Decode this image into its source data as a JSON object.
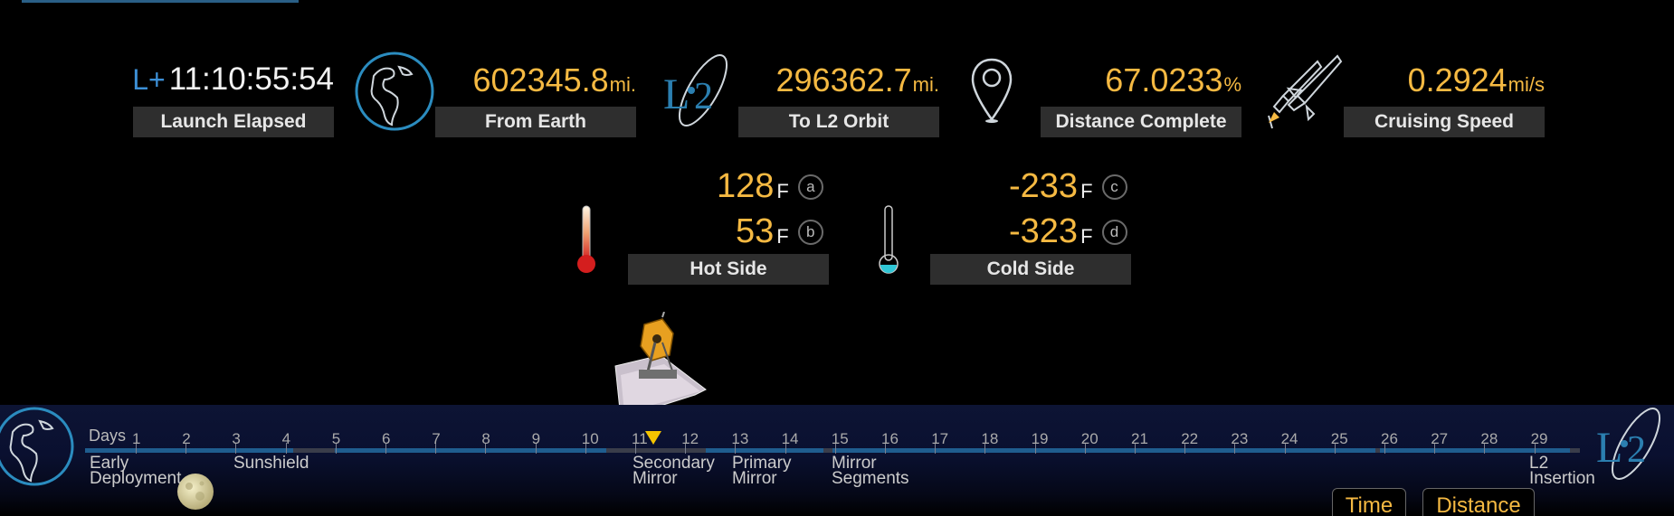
{
  "stats": {
    "elapsed": {
      "prefix": "L+",
      "value": "11:10:55:54",
      "label": "Launch Elapsed"
    },
    "from_earth": {
      "value": "602345.8",
      "unit": "mi.",
      "label": "From Earth"
    },
    "to_l2": {
      "value": "296362.7",
      "unit": "mi.",
      "label": "To L2 Orbit"
    },
    "distance": {
      "value": "67.0233",
      "unit": "%",
      "label": "Distance Complete"
    },
    "speed": {
      "value": "0.2924",
      "unit": "mi/s",
      "label": "Cruising Speed"
    }
  },
  "temps": {
    "hot": {
      "a": {
        "value": "128",
        "unit": "F",
        "badge": "a"
      },
      "b": {
        "value": "53",
        "unit": "F",
        "badge": "b"
      },
      "label": "Hot Side"
    },
    "cold": {
      "c": {
        "value": "-233",
        "unit": "F",
        "badge": "c"
      },
      "d": {
        "value": "-323",
        "unit": "F",
        "badge": "d"
      },
      "label": "Cold Side"
    }
  },
  "icons": {
    "earth": "earth-globe-icon",
    "l2": "l2-logo-icon",
    "pin": "location-pin-icon",
    "rocket": "rocket-icon",
    "thermo_hot": "thermometer-hot-icon",
    "thermo_cold": "thermometer-cold-icon",
    "telescope": "webb-telescope-icon",
    "moon": "moon-icon"
  },
  "timeline": {
    "days_label": "Days",
    "days": [
      "1",
      "2",
      "3",
      "4",
      "5",
      "6",
      "7",
      "8",
      "9",
      "10",
      "11",
      "12",
      "13",
      "14",
      "15",
      "16",
      "17",
      "18",
      "19",
      "20",
      "21",
      "22",
      "23",
      "24",
      "25",
      "26",
      "27",
      "28",
      "29"
    ],
    "current_day": 11.3,
    "milestones": [
      {
        "l1": "Early",
        "l2": "Deployment"
      },
      {
        "l1": "Sunshield",
        "l2": ""
      },
      {
        "l1": "Secondary",
        "l2": "Mirror"
      },
      {
        "l1": "Primary",
        "l2": "Mirror"
      },
      {
        "l1": "Mirror",
        "l2": "Segments"
      },
      {
        "l1": "L2",
        "l2": "Insertion"
      }
    ]
  },
  "buttons": {
    "time": "Time",
    "distance": "Distance"
  },
  "colors": {
    "accent": "#f5b942",
    "blue": "#3c8fd6",
    "track_active": "#1f5d8f",
    "marker": "#f5c400"
  }
}
